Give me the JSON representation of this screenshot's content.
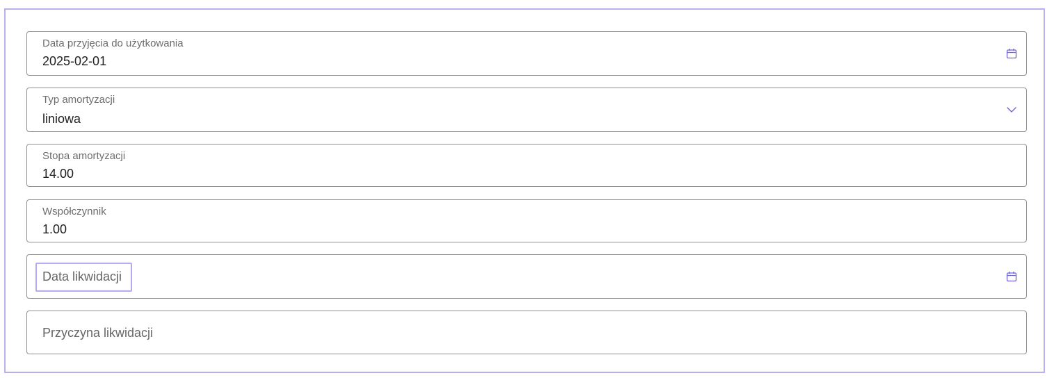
{
  "form": {
    "fields": [
      {
        "label": "Data przyjęcia do użytkowania",
        "value": "2025-02-01",
        "icon": "calendar-icon"
      },
      {
        "label": "Typ amortyzacji",
        "value": "liniowa",
        "icon": "chevron-down-icon"
      },
      {
        "label": "Stopa amortyzacji",
        "value": "14.00"
      },
      {
        "label": "Współczynnik",
        "value": "1.00"
      },
      {
        "placeholder": "Data likwidacji",
        "icon": "calendar-icon"
      },
      {
        "placeholder": "Przyczyna likwidacji"
      }
    ]
  },
  "colors": {
    "accent": "#6c63d9",
    "frame_border": "#b7b2ee",
    "field_border": "#8f8f8f"
  }
}
